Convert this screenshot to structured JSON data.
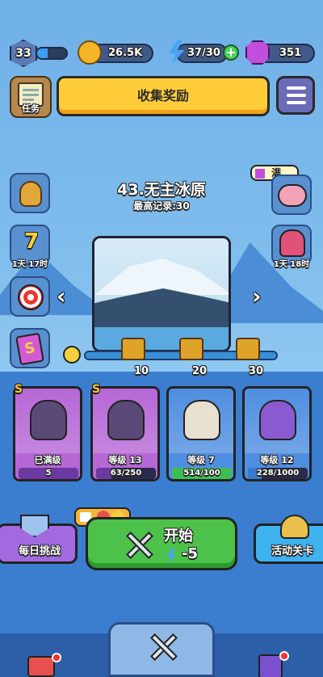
{
  "top_bar": {
    "player_level": "33",
    "xp_fraction": 0.35,
    "coins": "26.5K",
    "energy": "37/30",
    "gems": "351"
  },
  "quest": {
    "label": "任务"
  },
  "collect_button": {
    "label": "收集奖励"
  },
  "side_left": [
    {
      "name": "money-bag",
      "label": ""
    },
    {
      "name": "seven-pack",
      "label": "1天 17时"
    },
    {
      "name": "target-dart",
      "label": ""
    },
    {
      "name": "s-card",
      "label": ""
    }
  ],
  "side_right": [
    {
      "name": "piggy-bank",
      "label": "",
      "badge": "满"
    },
    {
      "name": "girl-pack",
      "label": "1天 18时"
    }
  ],
  "stage": {
    "title": "43.无主冰原",
    "record": "最高记录:30"
  },
  "chests": [
    {
      "label": "10"
    },
    {
      "label": "20"
    },
    {
      "label": "30"
    }
  ],
  "cards": [
    {
      "name": "已满级",
      "progress_text": "5",
      "fill": 1.0,
      "color": "#b667d6",
      "bar_color": "#6b3aa0",
      "rank": "S"
    },
    {
      "name": "等级 13",
      "progress_text": "63/250",
      "fill": 0.25,
      "color": "#b667d6",
      "bar_color": "#6b3aa0",
      "rank": "S"
    },
    {
      "name": "等级 7",
      "progress_text": "514/100",
      "fill": 1.0,
      "color": "#4f8ee0",
      "bar_color": "#3cbf52",
      "rank": ""
    },
    {
      "name": "等级 12",
      "progress_text": "228/1000",
      "fill": 0.23,
      "color": "#4f8ee0",
      "bar_color": "#3a7ad0",
      "rank": ""
    }
  ],
  "daily_challenge": {
    "label": "每日挑战"
  },
  "start_button": {
    "label": "开始",
    "cost": "-5"
  },
  "event_level": {
    "label": "活动关卡"
  }
}
